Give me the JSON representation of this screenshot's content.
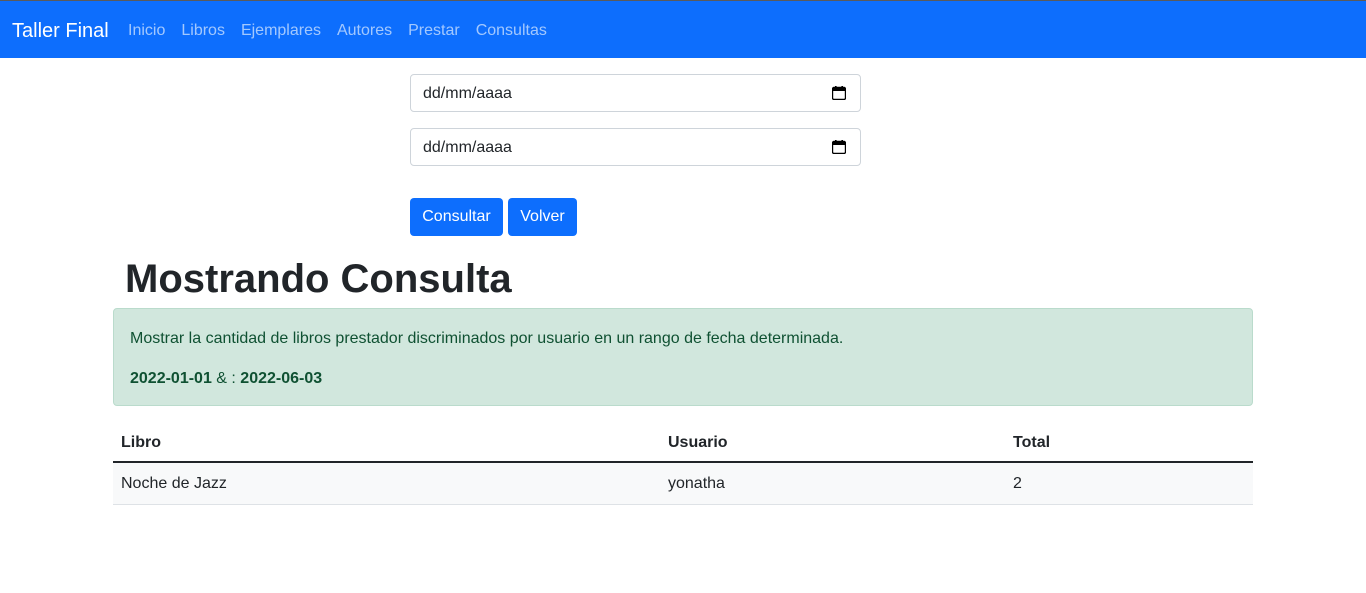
{
  "navbar": {
    "brand": "Taller Final",
    "links": [
      "Inicio",
      "Libros",
      "Ejemplares",
      "Autores",
      "Prestar",
      "Consultas"
    ],
    "color": "#0d6efd"
  },
  "form": {
    "date_from_placeholder": "dd/mm/aaaa",
    "date_to_placeholder": "dd/mm/aaaa",
    "consultar_label": "Consultar",
    "volver_label": "Volver"
  },
  "result": {
    "title": "Mostrando Consulta",
    "description": "Mostrar la cantidad de libros prestador discriminados por usuario en un rango de fecha determinada.",
    "date_start": "2022-01-01",
    "separator": " & : ",
    "date_end": "2022-06-03"
  },
  "table": {
    "headers": [
      "Libro",
      "Usuario",
      "Total"
    ],
    "rows": [
      [
        "Noche de Jazz",
        "yonatha",
        "2"
      ]
    ]
  },
  "icons": {
    "calendar": "calendar-icon"
  }
}
